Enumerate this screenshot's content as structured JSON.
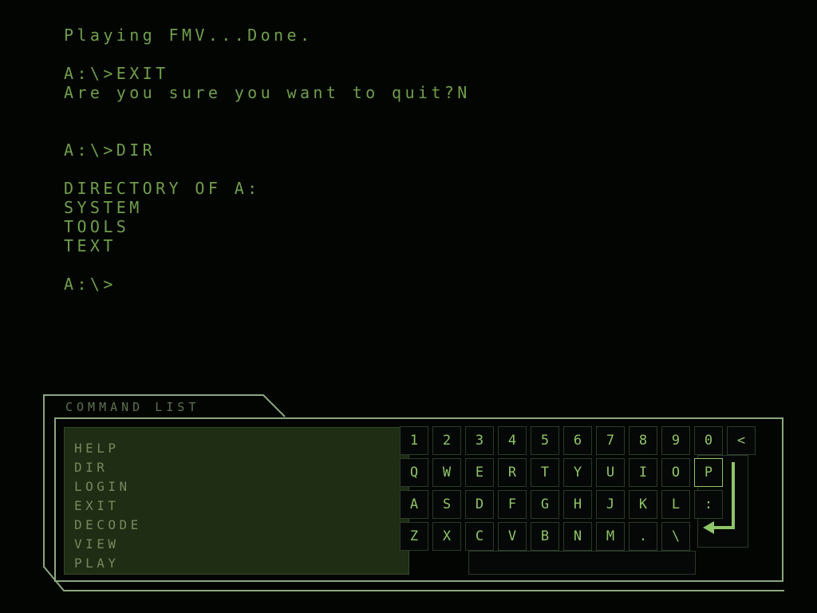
{
  "theme": {
    "background": "#030503",
    "terminal_text": "#6f9e4c",
    "frame_line": "#8aa77e",
    "tab_text": "#5e7150",
    "command_panel_background": "#1e2d13",
    "command_text": "#77885f",
    "key_text": "#8dc466",
    "key_border": "#2c3a2b",
    "key_selected_border": "#8fc468",
    "key_background": "#050806"
  },
  "terminal": {
    "lines": [
      "Playing FMV...Done.",
      "",
      "A:\\>EXIT",
      "Are you sure you want to quit?N",
      "",
      "",
      "A:\\>DIR",
      "",
      "DIRECTORY OF A:",
      "SYSTEM",
      "TOOLS",
      "TEXT",
      "",
      "A:\\>"
    ]
  },
  "panel": {
    "tab_title": "COMMAND LIST",
    "commands": [
      "HELP",
      "DIR",
      "LOGIN",
      "EXIT",
      "DECODE",
      "VIEW",
      "PLAY"
    ]
  },
  "keyboard": {
    "selected_key": "P",
    "rows": [
      {
        "name": "row-digits",
        "keys": [
          "1",
          "2",
          "3",
          "4",
          "5",
          "6",
          "7",
          "8",
          "9",
          "0",
          "<"
        ]
      },
      {
        "name": "row-qwerty",
        "keys": [
          "Q",
          "W",
          "E",
          "R",
          "T",
          "Y",
          "U",
          "I",
          "O",
          "P"
        ]
      },
      {
        "name": "row-asdf",
        "keys": [
          "A",
          "S",
          "D",
          "F",
          "G",
          "H",
          "J",
          "K",
          "L",
          ":"
        ]
      },
      {
        "name": "row-zxcv",
        "keys": [
          "Z",
          "X",
          "C",
          "V",
          "B",
          "N",
          "M",
          ".",
          "\\"
        ]
      }
    ],
    "enter_key_label": "enter",
    "space_key_label": "space"
  }
}
